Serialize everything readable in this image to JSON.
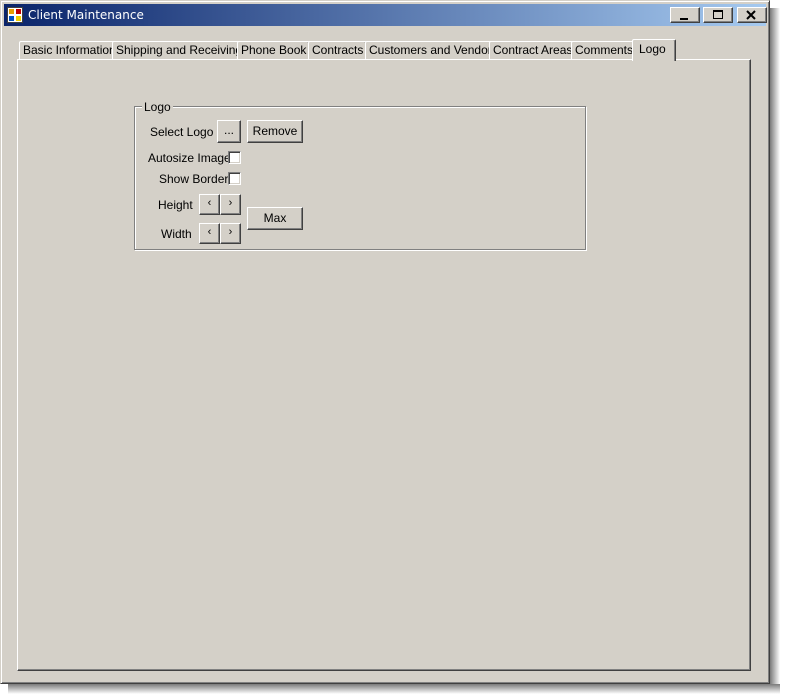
{
  "window": {
    "title": "Client Maintenance",
    "controls": {
      "minimize": "minimize-icon",
      "maximize": "maximize-icon",
      "close": "close-icon"
    }
  },
  "tabs": [
    {
      "label": "Basic Information"
    },
    {
      "label": "Shipping and Receiving"
    },
    {
      "label": "Phone Book"
    },
    {
      "label": "Contracts"
    },
    {
      "label": "Customers and Vendors"
    },
    {
      "label": "Contract Areas"
    },
    {
      "label": "Comments"
    },
    {
      "label": "Logo",
      "active": true
    }
  ],
  "logo_group": {
    "legend": "Logo",
    "select_logo_label": "Select Logo",
    "browse_button": "...",
    "remove_button": "Remove",
    "autosize_label": "Autosize Image",
    "autosize_checked": false,
    "show_border_label": "Show Border",
    "show_border_checked": false,
    "height_label": "Height",
    "width_label": "Width",
    "decrease_glyph": "‹",
    "increase_glyph": "›",
    "max_button": "Max"
  }
}
